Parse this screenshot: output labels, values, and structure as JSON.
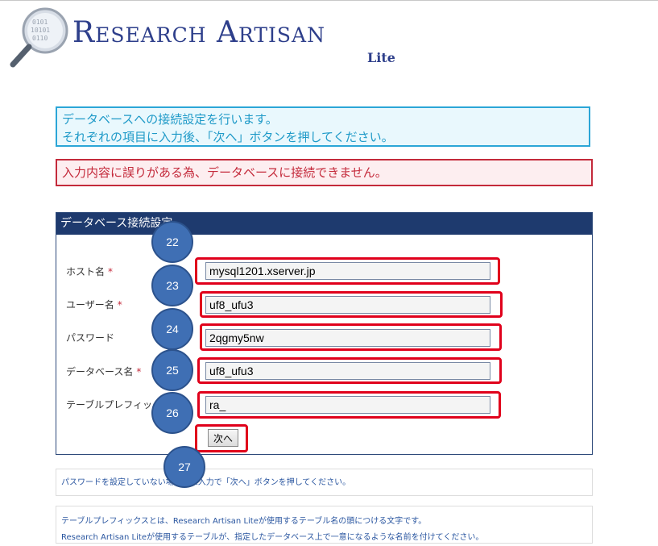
{
  "logo": {
    "title": "Research Artisan",
    "subtitle": "Lite"
  },
  "messages": {
    "info_line1": "データベースへの接続設定を行います。",
    "info_line2": "それぞれの項目に入力後、「次へ」ボタンを押してください。",
    "error": "入力内容に誤りがある為、データベースに接続できません。"
  },
  "panel": {
    "title": "データベース接続設定",
    "fields": [
      {
        "label": "ホスト名",
        "required_mark": "*",
        "value": "mysql1201.xserver.jp"
      },
      {
        "label": "ユーザー名",
        "required_mark": "*",
        "value": "uf8_ufu3"
      },
      {
        "label": "パスワード",
        "required_mark": "",
        "value": "2qgmy5nw"
      },
      {
        "label": "データベース名",
        "required_mark": "*",
        "value": "uf8_ufu3"
      },
      {
        "label": "テーブルプレフィックス",
        "required_mark": "",
        "value": "ra_"
      }
    ],
    "next_label": "次へ"
  },
  "annotations": [
    "22",
    "23",
    "24",
    "25",
    "26",
    "27"
  ],
  "notes": {
    "password_note": "パスワードを設定していない場合は未入力で「次へ」ボタンを押してください。",
    "prefix_line1": "テーブルプレフィックスとは、Research Artisan Liteが使用するテーブル名の頭につける文字です。",
    "prefix_line2": "Research Artisan Liteが使用するテーブルが、指定したデータベース上で一意になるような名前を付けてください。"
  },
  "colors": {
    "brand": "#2e3f8b",
    "info_border": "#2ba6d7",
    "error": "#c42a3b",
    "panel_header": "#1e3a6e",
    "highlight": "#e0001b",
    "badge": "#3f6fb4"
  }
}
